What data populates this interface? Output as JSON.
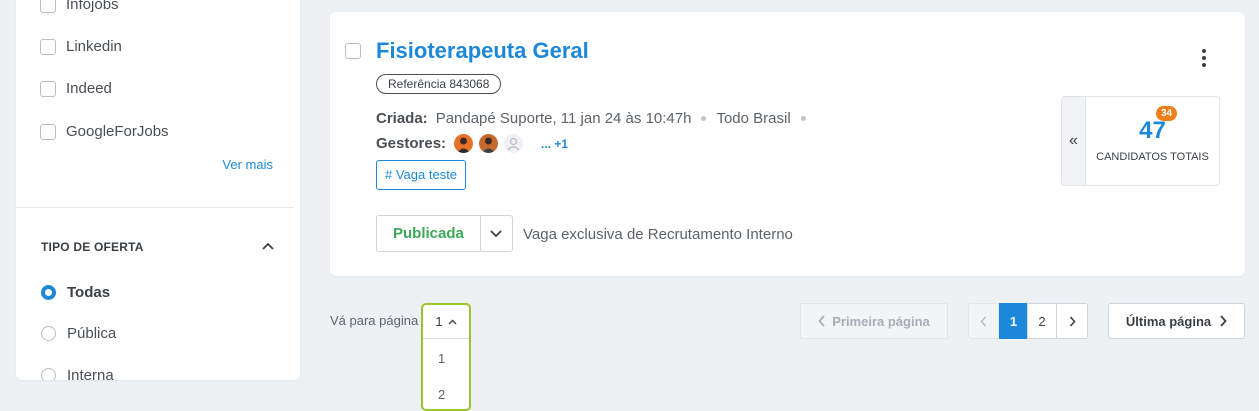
{
  "sidebar": {
    "sources": [
      {
        "label": "Infojobs",
        "checked": false
      },
      {
        "label": "Linkedin",
        "checked": false
      },
      {
        "label": "Indeed",
        "checked": false
      },
      {
        "label": "GoogleForJobs",
        "checked": false
      }
    ],
    "see_more": "Ver mais",
    "offer_type": {
      "title": "TIPO DE OFERTA",
      "options": [
        {
          "label": "Todas",
          "selected": true
        },
        {
          "label": "Pública",
          "selected": false
        },
        {
          "label": "Interna",
          "selected": false
        }
      ]
    }
  },
  "job": {
    "title": "Fisioterapeuta Geral",
    "reference": "Referência 843068",
    "created_label": "Criada:",
    "created_value": "Pandapé Suporte, 11 jan 24 às 10:47h",
    "location": "Todo Brasil",
    "managers_label": "Gestores:",
    "managers_more": "... +1",
    "tag": "# Vaga teste",
    "status": "Publicada",
    "status_color": "#3aa856",
    "exclusive_note": "Vaga exclusiva de Recrutamento Interno",
    "candidates": {
      "total": "47",
      "new_badge": "34",
      "label": "CANDIDATOS TOTAIS"
    }
  },
  "pagination": {
    "goto_label": "Vá para página",
    "current": "1",
    "options": [
      "1",
      "2"
    ],
    "first_page": "Primeira página",
    "pages": [
      "1",
      "2"
    ],
    "active_page": "1",
    "last_page": "Última página"
  },
  "colors": {
    "accent": "#1e88d8",
    "badge": "#f07f1b",
    "select_border": "#9bc42c"
  }
}
